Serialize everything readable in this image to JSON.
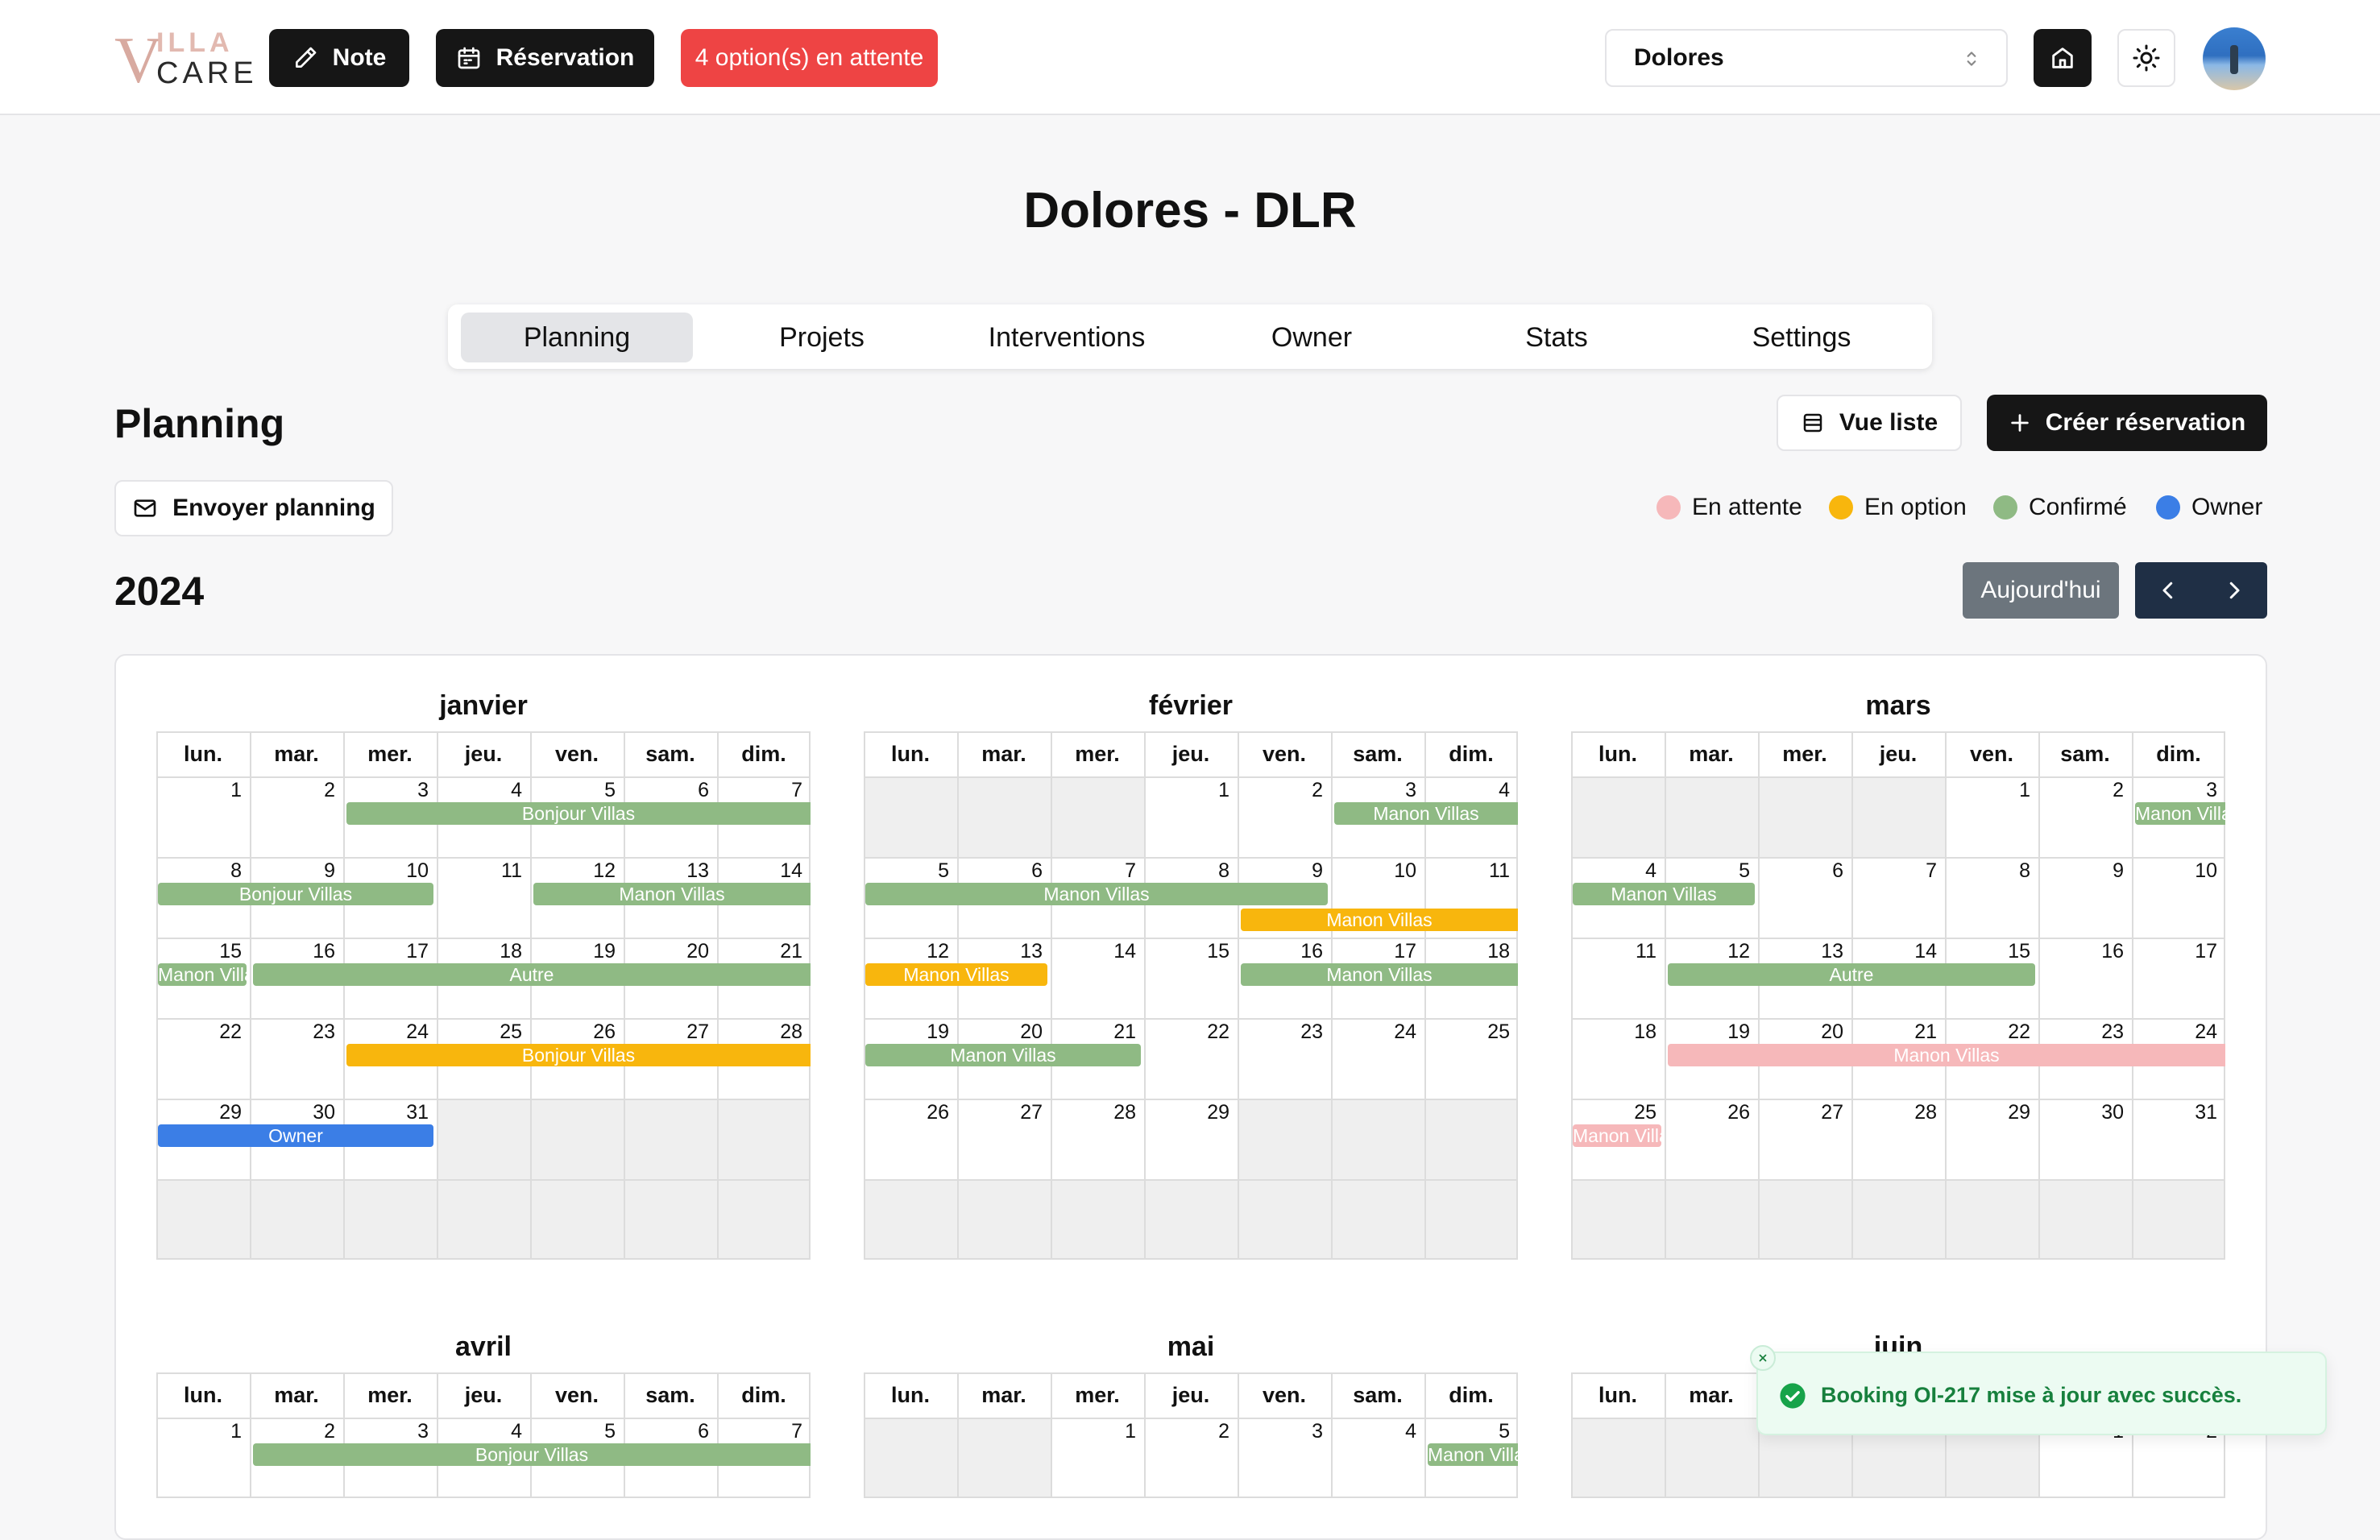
{
  "header": {
    "logo": {
      "v": "V",
      "illa": "ILLA",
      "care": "CARE"
    },
    "note_label": "Note",
    "reservation_label": "Réservation",
    "pending_label": "4 option(s) en attente",
    "property_select": "Dolores",
    "icons": [
      "pencil-icon",
      "calendar-icon",
      "chevron-updown-icon",
      "home-icon",
      "sun-icon"
    ]
  },
  "page": {
    "title": "Dolores - DLR",
    "tabs": [
      "Planning",
      "Projets",
      "Interventions",
      "Owner",
      "Stats",
      "Settings"
    ],
    "active_tab": "Planning"
  },
  "planning": {
    "title": "Planning",
    "list_view_label": "Vue liste",
    "create_label": "Créer réservation",
    "send_label": "Envoyer planning",
    "year": "2024",
    "today_label": "Aujourd'hui",
    "legend": [
      {
        "label": "En attente",
        "color": "#f6b8ba"
      },
      {
        "label": "En option",
        "color": "#f8b60d"
      },
      {
        "label": "Confirmé",
        "color": "#8fba84"
      },
      {
        "label": "Owner",
        "color": "#3b7ee6"
      }
    ]
  },
  "weekdays": [
    "lun.",
    "mar.",
    "mer.",
    "jeu.",
    "ven.",
    "sam.",
    "dim."
  ],
  "months": [
    {
      "name": "janvier",
      "offset": 0,
      "days": 31,
      "rows": 6,
      "bookings": [
        {
          "label": "Bonjour Villas",
          "status": "confirm",
          "start": 3,
          "end": 7
        },
        {
          "label": "Bonjour Villas",
          "status": "confirm",
          "start": 8,
          "end": 10
        },
        {
          "label": "Manon Villas",
          "status": "confirm",
          "start": 12,
          "end": 14
        },
        {
          "label": "Manon Villas",
          "status": "confirm",
          "start": 15,
          "end": 15
        },
        {
          "label": "Autre",
          "status": "confirm",
          "start": 16,
          "end": 21
        },
        {
          "label": "Bonjour Villas",
          "status": "option",
          "start": 24,
          "end": 28
        },
        {
          "label": "Owner",
          "status": "owner",
          "start": 29,
          "end": 31
        }
      ]
    },
    {
      "name": "février",
      "offset": 3,
      "days": 29,
      "rows": 6,
      "bookings": [
        {
          "label": "Manon Villas",
          "status": "confirm",
          "start": 3,
          "end": 4
        },
        {
          "label": "Manon Villas",
          "status": "confirm",
          "start": 5,
          "end": 9
        },
        {
          "label": "Manon Villas",
          "status": "option",
          "start": 9,
          "end": 11,
          "lane": 1
        },
        {
          "label": "Manon Villas",
          "status": "option",
          "start": 12,
          "end": 13
        },
        {
          "label": "Manon Villas",
          "status": "confirm",
          "start": 16,
          "end": 18
        },
        {
          "label": "Manon Villas",
          "status": "confirm",
          "start": 19,
          "end": 21
        }
      ]
    },
    {
      "name": "mars",
      "offset": 4,
      "days": 31,
      "rows": 6,
      "bookings": [
        {
          "label": "Manon Villas",
          "status": "confirm",
          "start": 3,
          "end": 3
        },
        {
          "label": "Manon Villas",
          "status": "confirm",
          "start": 4,
          "end": 5
        },
        {
          "label": "Autre",
          "status": "confirm",
          "start": 12,
          "end": 15
        },
        {
          "label": "Manon Villas",
          "status": "pending",
          "start": 19,
          "end": 24
        },
        {
          "label": "Manon Villas",
          "status": "pending",
          "start": 25,
          "end": 25
        }
      ]
    },
    {
      "name": "avril",
      "offset": 0,
      "days": 7,
      "rows": 1,
      "bookings": [
        {
          "label": "Bonjour Villas",
          "status": "confirm",
          "start": 2,
          "end": 7
        }
      ]
    },
    {
      "name": "mai",
      "offset": 2,
      "days": 5,
      "rows": 1,
      "bookings": [
        {
          "label": "Manon Villas",
          "status": "confirm",
          "start": 5,
          "end": 5
        }
      ]
    },
    {
      "name": "juin",
      "offset": 5,
      "days": 2,
      "rows": 1,
      "bookings": []
    }
  ],
  "toast": {
    "message": "Booking OI-217 mise à jour avec succès."
  }
}
